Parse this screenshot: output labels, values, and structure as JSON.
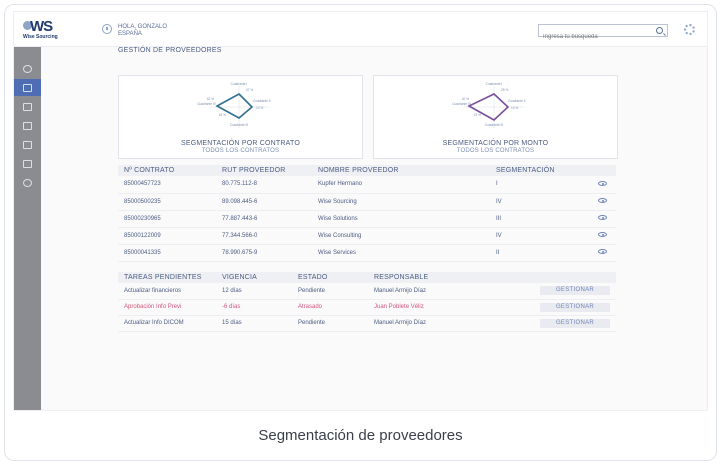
{
  "brand": {
    "logo_text": "WS",
    "logo_sub": "Wise Sourcing"
  },
  "user": {
    "greeting": "HOLA, GONZALO",
    "country": "ESPAÑA"
  },
  "search": {
    "placeholder": "Ingresa tu búsqueda"
  },
  "page": {
    "title": "GESTIÓN DE PROVEEDORES"
  },
  "panels": [
    {
      "title": "SEGMENTACIÓN POR CONTRATO",
      "subtitle": "TODOS LOS CONTRATOS",
      "color": "#2f6f8f",
      "labels": {
        "top": "Cuadrante I",
        "top_value": "37 %",
        "right": "Cuadrante II",
        "right_value": "13 %",
        "bottom": "Cuadrante III",
        "bottom_value": "18 %",
        "left": "Cuadrante IV",
        "left_value": "42 %"
      }
    },
    {
      "title": "SEGMENTACIÓN POR MONTO",
      "subtitle": "TODOS LOS CONTRATOS",
      "color": "#7a4f9a",
      "labels": {
        "top": "Cuadrante I",
        "top_value": "28 %",
        "right": "Cuadrante II",
        "right_value": "13 %",
        "bottom": "Cuadrante III",
        "bottom_value": "19 %",
        "left": "Cuadrante IV",
        "left_value": "40 %"
      }
    }
  ],
  "contracts": {
    "headers": [
      "Nº CONTRATO",
      "RUT PROVEEDOR",
      "NOMBRE PROVEEDOR",
      "SEGMENTACIÓN"
    ],
    "rows": [
      {
        "contract": "85000457723",
        "rut": "80.775.112-8",
        "name": "Kupfer Hermano",
        "segment": "I",
        "highlight": false
      },
      {
        "contract": "85000500235",
        "rut": "89.098.445-6",
        "name": "Wise Sourcing",
        "segment": "IV",
        "highlight": false
      },
      {
        "contract": "85000230965",
        "rut": "77.887.443-6",
        "name": "Wise Solutions",
        "segment": "III",
        "highlight": false
      },
      {
        "contract": "85000122009",
        "rut": "77.344.566-0",
        "name": "Wise Consulting",
        "segment": "IV",
        "highlight": true
      },
      {
        "contract": "85000041335",
        "rut": "78.990.675-9",
        "name": "Wise Services",
        "segment": "II",
        "highlight": false
      }
    ]
  },
  "tasks": {
    "headers": [
      "TAREAS PENDIENTES",
      "VIGENCIA",
      "ESTADO",
      "RESPONSABLE"
    ],
    "action_label": "GESTIONAR",
    "rows": [
      {
        "task": "Actualizar financieros",
        "term": "12 días",
        "status": "Pendiente",
        "owner": "Manuel Armijo Díaz",
        "late": false
      },
      {
        "task": "Aprobación Info Previ",
        "term": "-6 días",
        "status": "Atrasado",
        "owner": "Juan Poblete Véliz",
        "late": true
      },
      {
        "task": "Actualizar Info DICOM",
        "term": "15 días",
        "status": "Pendiente",
        "owner": "Manuel Armijo Díaz",
        "late": false
      }
    ]
  },
  "caption": "Segmentación de proveedores",
  "icons": {
    "sidebar": [
      "home-icon",
      "suppliers-icon",
      "contracts-icon",
      "reports-icon",
      "calendar-icon",
      "balance-icon",
      "money-icon"
    ],
    "active_sidebar_index": 1
  }
}
